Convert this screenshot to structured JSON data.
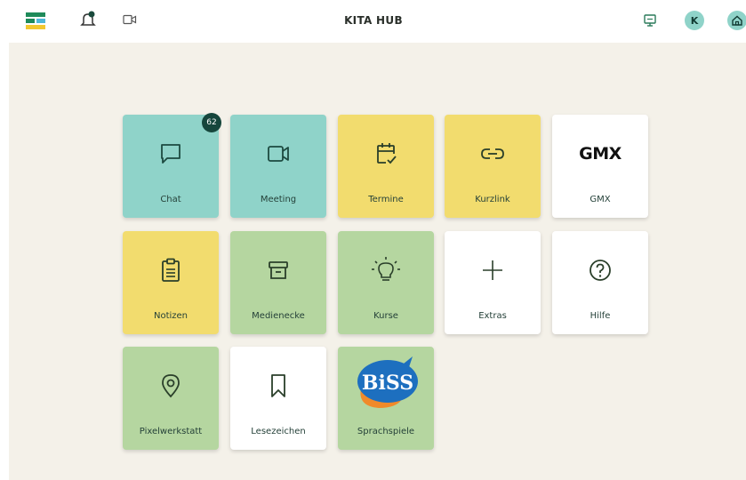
{
  "app": {
    "title": "KITA HUB"
  },
  "header": {
    "avatar_initial": "K"
  },
  "tiles": [
    {
      "label": "Chat",
      "icon": "chat-bubble-icon",
      "color": "#8fd3c9",
      "badge": "62"
    },
    {
      "label": "Meeting",
      "icon": "video-camera-icon",
      "color": "#8fd3c9"
    },
    {
      "label": "Termine",
      "icon": "calendar-check-icon",
      "color": "#f2dc6e"
    },
    {
      "label": "Kurzlink",
      "icon": "link-icon",
      "color": "#f2dc6e"
    },
    {
      "label": "GMX",
      "icon": "gmx-logo",
      "color": "#ffffff",
      "logo_text": "GMX"
    },
    {
      "label": "Notizen",
      "icon": "clipboard-icon",
      "color": "#f2dc6e"
    },
    {
      "label": "Medienecke",
      "icon": "archive-box-icon",
      "color": "#b5d6a0"
    },
    {
      "label": "Kurse",
      "icon": "lightbulb-icon",
      "color": "#b5d6a0"
    },
    {
      "label": "Extras",
      "icon": "plus-icon",
      "color": "#ffffff"
    },
    {
      "label": "Hilfe",
      "icon": "question-circle-icon",
      "color": "#ffffff"
    },
    {
      "label": "Pixelwerkstatt",
      "icon": "location-pin-icon",
      "color": "#b5d6a0"
    },
    {
      "label": "Lesezeichen",
      "icon": "bookmark-icon",
      "color": "#ffffff"
    },
    {
      "label": "Sprachspiele",
      "icon": "biss-logo",
      "color": "#b5d6a0",
      "logo_text": "BiSS"
    }
  ]
}
